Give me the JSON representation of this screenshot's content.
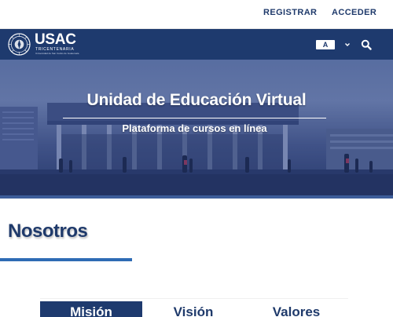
{
  "topbar": {
    "register_label": "REGISTRAR",
    "login_label": "ACCEDER"
  },
  "navbar": {
    "logo_text": "USAC",
    "logo_subtitle": "TRICENTENARIA",
    "logo_caption": "Universidad de San Carlos de Guatemala",
    "a11y_label": "A",
    "icons": [
      "seal-icon",
      "chevron-down-icon",
      "search-icon"
    ]
  },
  "hero": {
    "title": "Unidad de Educación Virtual",
    "subtitle": "Plataforma de cursos en línea"
  },
  "section": {
    "title": "Nosotros"
  },
  "tabs": [
    {
      "label": "Misión",
      "active": true
    },
    {
      "label": "Visión",
      "active": false
    },
    {
      "label": "Valores",
      "active": false
    }
  ],
  "colors": {
    "navy": "#1e3a6e",
    "accent": "#2e6bb4",
    "heading": "#1f3a6b"
  }
}
